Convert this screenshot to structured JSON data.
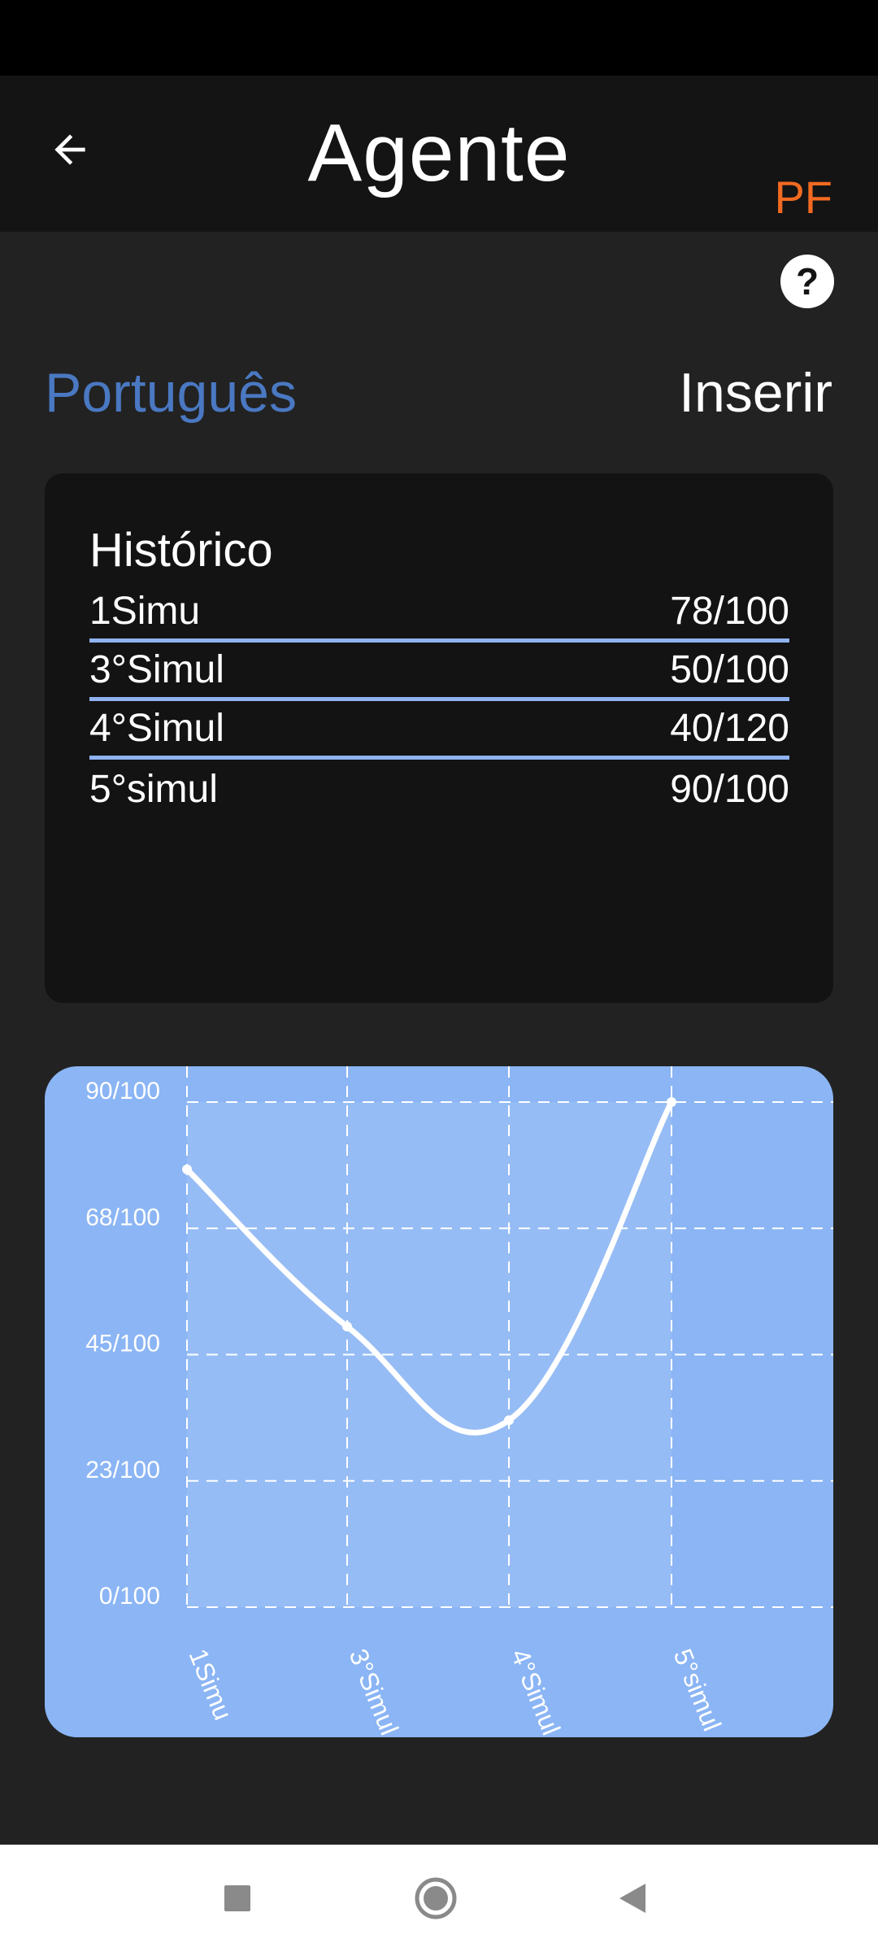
{
  "app_bar": {
    "title": "Agente",
    "badge": "PF",
    "back_icon": "arrow-left-icon"
  },
  "help": {
    "label": "?"
  },
  "subject": {
    "label": "Português",
    "color": "#4a78c2"
  },
  "insert": {
    "label": "Inserir"
  },
  "history": {
    "title": "Histórico",
    "rows": [
      {
        "name": "1Simu",
        "score": "78/100"
      },
      {
        "name": "3°Simul",
        "score": "50/100"
      },
      {
        "name": "4°Simul",
        "score": "40/120"
      },
      {
        "name": "5°simul",
        "score": "90/100"
      }
    ]
  },
  "chart_data": {
    "type": "line",
    "categories": [
      "1Simu",
      "3°Simul",
      "4°Simul",
      "5°simul"
    ],
    "series": [
      {
        "values": [
          78,
          50,
          33.3,
          90
        ]
      }
    ],
    "y_tick_labels": [
      "0/100",
      "23/100",
      "45/100",
      "68/100",
      "90/100"
    ],
    "y_tick_values": [
      0,
      22.5,
      45,
      67.5,
      90
    ],
    "ylim": [
      0,
      90
    ],
    "grid": true,
    "line_color": "#ffffff",
    "background": "#8bb5f4"
  },
  "nav": {
    "recent_icon": "square-icon",
    "home_icon": "circle-icon",
    "back_icon": "triangle-back-icon"
  }
}
